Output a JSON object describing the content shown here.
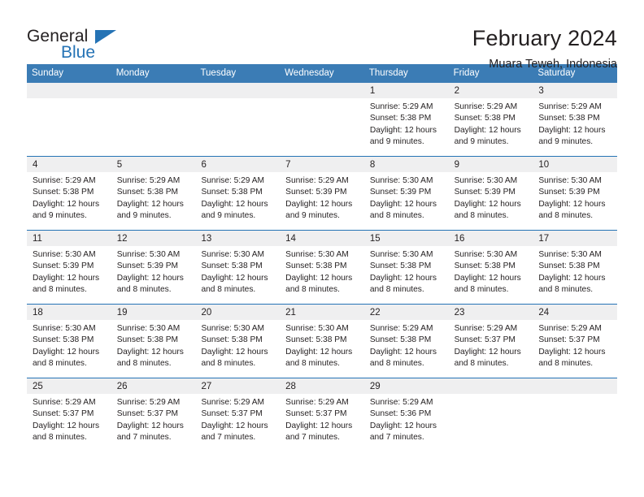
{
  "brand": {
    "name_part1": "General",
    "name_part2": "Blue",
    "mark": "triangle-logo",
    "accent_color": "#2573b5"
  },
  "header": {
    "title": "February 2024",
    "subtitle": "Muara Teweh, Indonesia"
  },
  "theme": {
    "header_row_background": "#3b7cb5",
    "header_row_text": "#ffffff",
    "day_band_background": "#efeff0",
    "row_separator": "#2573b5",
    "body_text": "#231f20"
  },
  "weekday_headers": [
    "Sunday",
    "Monday",
    "Tuesday",
    "Wednesday",
    "Thursday",
    "Friday",
    "Saturday"
  ],
  "weeks": [
    [
      {
        "day": "",
        "empty": true,
        "sunrise": "",
        "sunset": "",
        "daylight_line1": "",
        "daylight_line2": ""
      },
      {
        "day": "",
        "empty": true,
        "sunrise": "",
        "sunset": "",
        "daylight_line1": "",
        "daylight_line2": ""
      },
      {
        "day": "",
        "empty": true,
        "sunrise": "",
        "sunset": "",
        "daylight_line1": "",
        "daylight_line2": ""
      },
      {
        "day": "",
        "empty": true,
        "sunrise": "",
        "sunset": "",
        "daylight_line1": "",
        "daylight_line2": ""
      },
      {
        "day": "1",
        "empty": false,
        "sunrise": "Sunrise: 5:29 AM",
        "sunset": "Sunset: 5:38 PM",
        "daylight_line1": "Daylight: 12 hours",
        "daylight_line2": "and 9 minutes."
      },
      {
        "day": "2",
        "empty": false,
        "sunrise": "Sunrise: 5:29 AM",
        "sunset": "Sunset: 5:38 PM",
        "daylight_line1": "Daylight: 12 hours",
        "daylight_line2": "and 9 minutes."
      },
      {
        "day": "3",
        "empty": false,
        "sunrise": "Sunrise: 5:29 AM",
        "sunset": "Sunset: 5:38 PM",
        "daylight_line1": "Daylight: 12 hours",
        "daylight_line2": "and 9 minutes."
      }
    ],
    [
      {
        "day": "4",
        "empty": false,
        "sunrise": "Sunrise: 5:29 AM",
        "sunset": "Sunset: 5:38 PM",
        "daylight_line1": "Daylight: 12 hours",
        "daylight_line2": "and 9 minutes."
      },
      {
        "day": "5",
        "empty": false,
        "sunrise": "Sunrise: 5:29 AM",
        "sunset": "Sunset: 5:38 PM",
        "daylight_line1": "Daylight: 12 hours",
        "daylight_line2": "and 9 minutes."
      },
      {
        "day": "6",
        "empty": false,
        "sunrise": "Sunrise: 5:29 AM",
        "sunset": "Sunset: 5:38 PM",
        "daylight_line1": "Daylight: 12 hours",
        "daylight_line2": "and 9 minutes."
      },
      {
        "day": "7",
        "empty": false,
        "sunrise": "Sunrise: 5:29 AM",
        "sunset": "Sunset: 5:39 PM",
        "daylight_line1": "Daylight: 12 hours",
        "daylight_line2": "and 9 minutes."
      },
      {
        "day": "8",
        "empty": false,
        "sunrise": "Sunrise: 5:30 AM",
        "sunset": "Sunset: 5:39 PM",
        "daylight_line1": "Daylight: 12 hours",
        "daylight_line2": "and 8 minutes."
      },
      {
        "day": "9",
        "empty": false,
        "sunrise": "Sunrise: 5:30 AM",
        "sunset": "Sunset: 5:39 PM",
        "daylight_line1": "Daylight: 12 hours",
        "daylight_line2": "and 8 minutes."
      },
      {
        "day": "10",
        "empty": false,
        "sunrise": "Sunrise: 5:30 AM",
        "sunset": "Sunset: 5:39 PM",
        "daylight_line1": "Daylight: 12 hours",
        "daylight_line2": "and 8 minutes."
      }
    ],
    [
      {
        "day": "11",
        "empty": false,
        "sunrise": "Sunrise: 5:30 AM",
        "sunset": "Sunset: 5:39 PM",
        "daylight_line1": "Daylight: 12 hours",
        "daylight_line2": "and 8 minutes."
      },
      {
        "day": "12",
        "empty": false,
        "sunrise": "Sunrise: 5:30 AM",
        "sunset": "Sunset: 5:39 PM",
        "daylight_line1": "Daylight: 12 hours",
        "daylight_line2": "and 8 minutes."
      },
      {
        "day": "13",
        "empty": false,
        "sunrise": "Sunrise: 5:30 AM",
        "sunset": "Sunset: 5:38 PM",
        "daylight_line1": "Daylight: 12 hours",
        "daylight_line2": "and 8 minutes."
      },
      {
        "day": "14",
        "empty": false,
        "sunrise": "Sunrise: 5:30 AM",
        "sunset": "Sunset: 5:38 PM",
        "daylight_line1": "Daylight: 12 hours",
        "daylight_line2": "and 8 minutes."
      },
      {
        "day": "15",
        "empty": false,
        "sunrise": "Sunrise: 5:30 AM",
        "sunset": "Sunset: 5:38 PM",
        "daylight_line1": "Daylight: 12 hours",
        "daylight_line2": "and 8 minutes."
      },
      {
        "day": "16",
        "empty": false,
        "sunrise": "Sunrise: 5:30 AM",
        "sunset": "Sunset: 5:38 PM",
        "daylight_line1": "Daylight: 12 hours",
        "daylight_line2": "and 8 minutes."
      },
      {
        "day": "17",
        "empty": false,
        "sunrise": "Sunrise: 5:30 AM",
        "sunset": "Sunset: 5:38 PM",
        "daylight_line1": "Daylight: 12 hours",
        "daylight_line2": "and 8 minutes."
      }
    ],
    [
      {
        "day": "18",
        "empty": false,
        "sunrise": "Sunrise: 5:30 AM",
        "sunset": "Sunset: 5:38 PM",
        "daylight_line1": "Daylight: 12 hours",
        "daylight_line2": "and 8 minutes."
      },
      {
        "day": "19",
        "empty": false,
        "sunrise": "Sunrise: 5:30 AM",
        "sunset": "Sunset: 5:38 PM",
        "daylight_line1": "Daylight: 12 hours",
        "daylight_line2": "and 8 minutes."
      },
      {
        "day": "20",
        "empty": false,
        "sunrise": "Sunrise: 5:30 AM",
        "sunset": "Sunset: 5:38 PM",
        "daylight_line1": "Daylight: 12 hours",
        "daylight_line2": "and 8 minutes."
      },
      {
        "day": "21",
        "empty": false,
        "sunrise": "Sunrise: 5:30 AM",
        "sunset": "Sunset: 5:38 PM",
        "daylight_line1": "Daylight: 12 hours",
        "daylight_line2": "and 8 minutes."
      },
      {
        "day": "22",
        "empty": false,
        "sunrise": "Sunrise: 5:29 AM",
        "sunset": "Sunset: 5:38 PM",
        "daylight_line1": "Daylight: 12 hours",
        "daylight_line2": "and 8 minutes."
      },
      {
        "day": "23",
        "empty": false,
        "sunrise": "Sunrise: 5:29 AM",
        "sunset": "Sunset: 5:37 PM",
        "daylight_line1": "Daylight: 12 hours",
        "daylight_line2": "and 8 minutes."
      },
      {
        "day": "24",
        "empty": false,
        "sunrise": "Sunrise: 5:29 AM",
        "sunset": "Sunset: 5:37 PM",
        "daylight_line1": "Daylight: 12 hours",
        "daylight_line2": "and 8 minutes."
      }
    ],
    [
      {
        "day": "25",
        "empty": false,
        "sunrise": "Sunrise: 5:29 AM",
        "sunset": "Sunset: 5:37 PM",
        "daylight_line1": "Daylight: 12 hours",
        "daylight_line2": "and 8 minutes."
      },
      {
        "day": "26",
        "empty": false,
        "sunrise": "Sunrise: 5:29 AM",
        "sunset": "Sunset: 5:37 PM",
        "daylight_line1": "Daylight: 12 hours",
        "daylight_line2": "and 7 minutes."
      },
      {
        "day": "27",
        "empty": false,
        "sunrise": "Sunrise: 5:29 AM",
        "sunset": "Sunset: 5:37 PM",
        "daylight_line1": "Daylight: 12 hours",
        "daylight_line2": "and 7 minutes."
      },
      {
        "day": "28",
        "empty": false,
        "sunrise": "Sunrise: 5:29 AM",
        "sunset": "Sunset: 5:37 PM",
        "daylight_line1": "Daylight: 12 hours",
        "daylight_line2": "and 7 minutes."
      },
      {
        "day": "29",
        "empty": false,
        "sunrise": "Sunrise: 5:29 AM",
        "sunset": "Sunset: 5:36 PM",
        "daylight_line1": "Daylight: 12 hours",
        "daylight_line2": "and 7 minutes."
      },
      {
        "day": "",
        "empty": true,
        "sunrise": "",
        "sunset": "",
        "daylight_line1": "",
        "daylight_line2": ""
      },
      {
        "day": "",
        "empty": true,
        "sunrise": "",
        "sunset": "",
        "daylight_line1": "",
        "daylight_line2": ""
      }
    ]
  ]
}
